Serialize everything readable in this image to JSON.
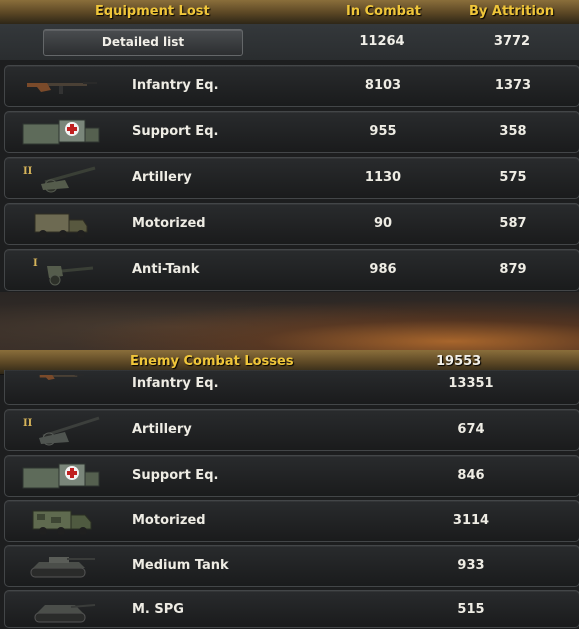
{
  "equipment_lost": {
    "header": {
      "title": "Equipment Lost",
      "col_combat": "In Combat",
      "col_attrition": "By Attrition"
    },
    "detail_button": "Detailed list",
    "totals": {
      "in_combat": "11264",
      "by_attrition": "3772"
    },
    "rows": [
      {
        "label": "Infantry Eq.",
        "icon": "rifle-icon",
        "in_combat": "8103",
        "by_attrition": "1373"
      },
      {
        "label": "Support Eq.",
        "icon": "medical-crate-icon",
        "in_combat": "955",
        "by_attrition": "358"
      },
      {
        "label": "Artillery",
        "icon": "howitzer-icon",
        "tier": "II",
        "in_combat": "1130",
        "by_attrition": "575"
      },
      {
        "label": "Motorized",
        "icon": "truck-icon",
        "in_combat": "90",
        "by_attrition": "587"
      },
      {
        "label": "Anti-Tank",
        "icon": "anti-tank-gun-icon",
        "tier": "I",
        "in_combat": "986",
        "by_attrition": "879"
      }
    ]
  },
  "enemy_losses": {
    "header": {
      "title": "Enemy Combat Losses",
      "total": "19553"
    },
    "rows": [
      {
        "label": "Infantry Eq.",
        "icon": "rifle-icon",
        "value": "13351"
      },
      {
        "label": "Artillery",
        "icon": "howitzer-icon",
        "tier": "II",
        "value": "674"
      },
      {
        "label": "Support Eq.",
        "icon": "medical-crate-icon",
        "value": "846"
      },
      {
        "label": "Motorized",
        "icon": "truck-icon",
        "value": "3114"
      },
      {
        "label": "Medium Tank",
        "icon": "tank-icon",
        "value": "933"
      },
      {
        "label": "M. SPG",
        "icon": "spg-icon",
        "value": "515"
      }
    ]
  },
  "colors": {
    "header_text": "#f0c63a",
    "header_bar": "#6a5330",
    "row_bg": "#222426",
    "value_text": "#eeece4"
  }
}
